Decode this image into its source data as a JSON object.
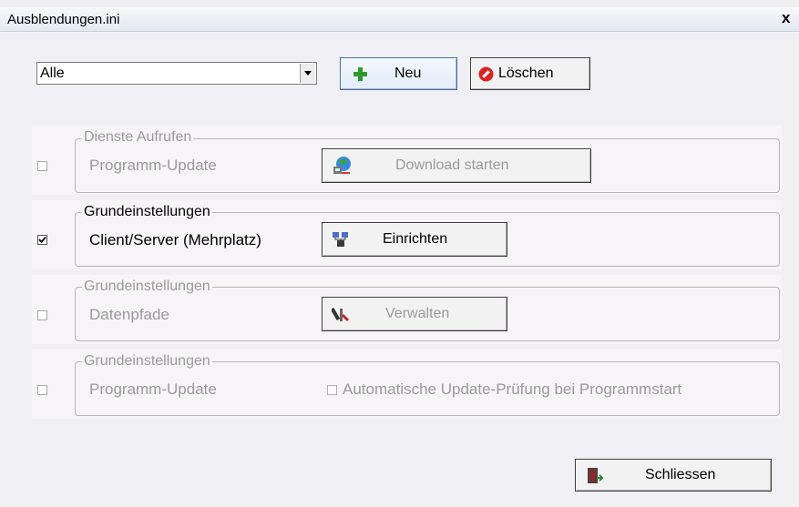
{
  "window": {
    "title": "Ausblendungen.ini",
    "close_label": "x"
  },
  "toolbar": {
    "filter_value": "Alle",
    "new_label": "Neu",
    "delete_label": "Löschen"
  },
  "rows": [
    {
      "group_title": "Dienste Aufrufen",
      "label": "Programm-Update",
      "checked": false,
      "enabled": false,
      "action_label": "Download starten"
    },
    {
      "group_title": "Grundeinstellungen",
      "label": "Client/Server (Mehrplatz)",
      "checked": true,
      "enabled": true,
      "action_label": "Einrichten"
    },
    {
      "group_title": "Grundeinstellungen",
      "label": "Datenpfade",
      "checked": false,
      "enabled": false,
      "action_label": "Verwalten"
    },
    {
      "group_title": "Grundeinstellungen",
      "label": "Programm-Update",
      "checked": false,
      "enabled": false,
      "option_label": "Automatische Update-Prüfung bei Programmstart"
    }
  ],
  "footer": {
    "close_label": "Schliessen"
  },
  "icons": {
    "new": "plus-icon",
    "delete": "stop-icon",
    "download": "globe-download-icon",
    "setup": "network-icon",
    "manage": "tools-icon",
    "close": "door-exit-icon"
  },
  "colors": {
    "disabled_text": "#9a9a9a",
    "group_bg": "#f6f4f6",
    "window_bg": "#f0f0f4"
  }
}
